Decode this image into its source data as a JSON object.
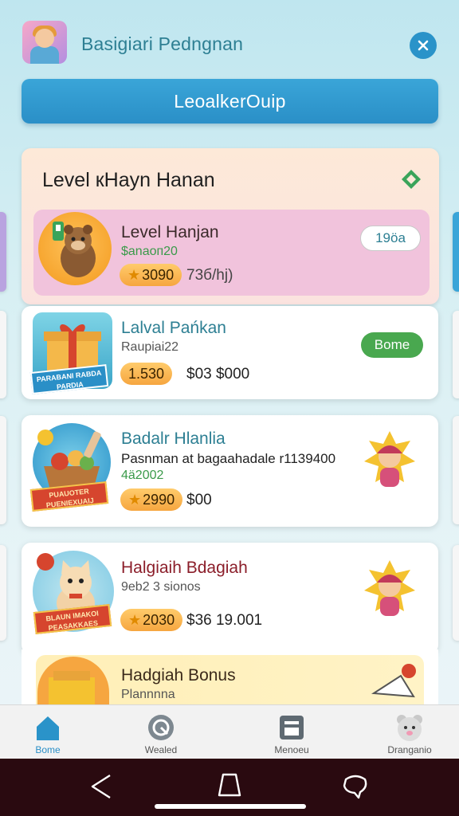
{
  "header": {
    "app_title": "Basigiari Pedngnan",
    "leaderboard_label": "LeoalkerOuip"
  },
  "level_section": {
    "title": "Level кHayn Hanan",
    "cards": [
      {
        "title": "Level Hanjan",
        "subtitle": "$anaoп20",
        "pill": "3090",
        "price": "73б/hj)",
        "badge": "19öa",
        "title_color": "#3b2a2a"
      }
    ]
  },
  "offers": [
    {
      "title": "Lalval Pańkan",
      "subtitle": "Raupiai22",
      "pill": "1.530",
      "price": "$03 $000",
      "badge": "Bome",
      "ribbon": "PARABANI RABDA PARDIA",
      "title_color": "#2d7f93"
    },
    {
      "title": "Badalr Hlanlia",
      "description": "Pasnman at bagaahadale r1139400",
      "subtitle": "4ä2002",
      "pill": "2990",
      "price": "$00",
      "ribbon": "PUAUOTER PUENIEXUAIJ",
      "title_color": "#2d7f93"
    },
    {
      "title": "Halgiaih Bdagiah",
      "subtitle": "9еb2 3 sionos",
      "pill": "2030",
      "price": "$36  19.001",
      "ribbon": "BLAUN IMAKOI PEASAKKAES",
      "title_color": "#8b1e2a"
    },
    {
      "title": "Hadgiah Bonus",
      "subtitle": "Plannnna",
      "title_color": "#3b2a1a"
    }
  ],
  "bottom_nav": [
    {
      "label": "Bome",
      "icon": "home-icon",
      "active": true
    },
    {
      "label": "Wealed",
      "icon": "refresh-icon",
      "active": false
    },
    {
      "label": "Menoeu",
      "icon": "menu-box-icon",
      "active": false
    },
    {
      "label": "Dranganio",
      "icon": "bear-avatar-icon",
      "active": false
    }
  ],
  "colors": {
    "accent": "#2a93c9",
    "pill": "#f6a640",
    "green_button": "#49a84f",
    "pink_card": "#f1c3dc",
    "system_bar": "#2a0a10"
  }
}
